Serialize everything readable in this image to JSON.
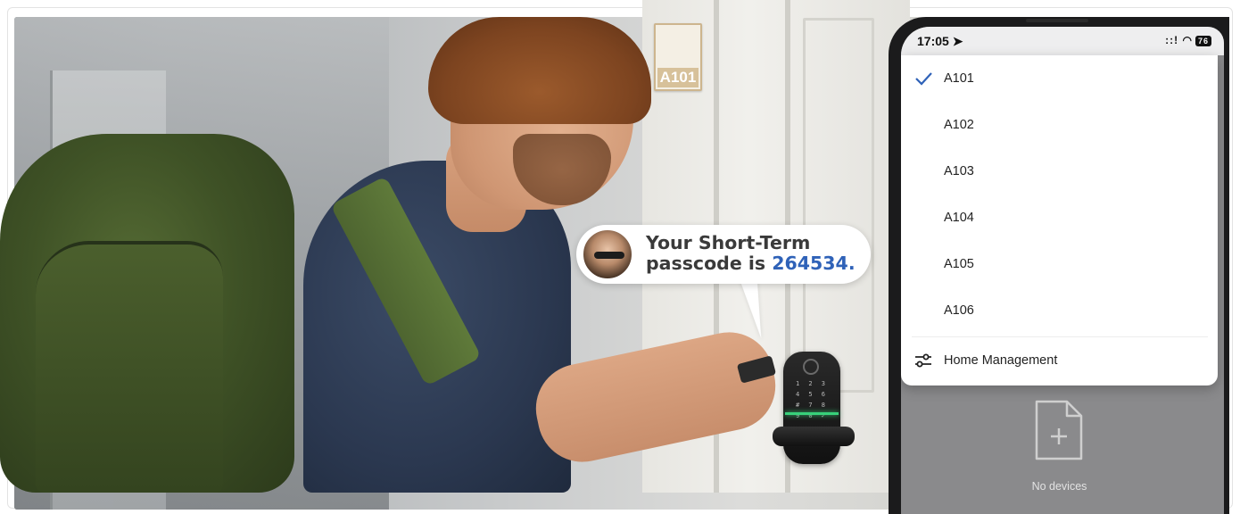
{
  "scene": {
    "room_sign": "A101",
    "lock_keypad": "1 2 3 4 5 6 # 7 8 9 0 ✓"
  },
  "bubble": {
    "line1": "Your Short-Term",
    "line2_prefix": "passcode is ",
    "passcode": "264534."
  },
  "phone": {
    "status_time": "17:05",
    "status_signal": "::!",
    "battery": "76",
    "rooms": [
      {
        "label": "A101",
        "selected": true
      },
      {
        "label": "A102",
        "selected": false
      },
      {
        "label": "A103",
        "selected": false
      },
      {
        "label": "A104",
        "selected": false
      },
      {
        "label": "A105",
        "selected": false
      },
      {
        "label": "A106",
        "selected": false
      }
    ],
    "footer_label": "Home Management",
    "empty_state": "No devices"
  },
  "colors": {
    "accent": "#2f62b8",
    "check": "#2f62b8",
    "lock_led": "#37d17a"
  }
}
